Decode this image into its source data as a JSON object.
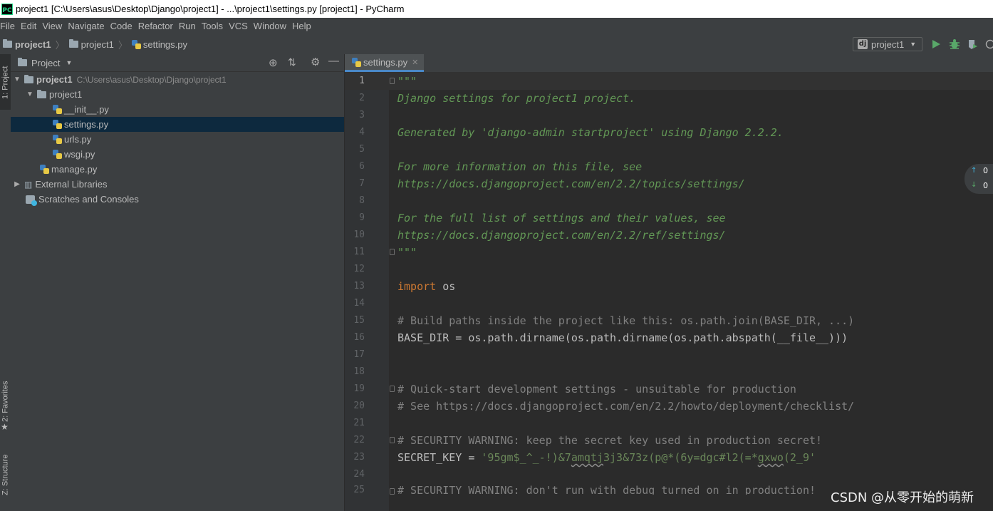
{
  "window": {
    "title": "project1 [C:\\Users\\asus\\Desktop\\Django\\project1] - ...\\project1\\settings.py [project1] - PyCharm",
    "logo": "PC"
  },
  "menu": [
    "File",
    "Edit",
    "View",
    "Navigate",
    "Code",
    "Refactor",
    "Run",
    "Tools",
    "VCS",
    "Window",
    "Help"
  ],
  "breadcrumb": {
    "root": "project1",
    "folder": "project1",
    "file": "settings.py"
  },
  "run_config": {
    "label": "project1",
    "icon": "dj"
  },
  "tool_tabs": {
    "project": "1: Project",
    "favorites": "2: Favorites",
    "structure": "Z: Structure"
  },
  "project_panel": {
    "title": "Project",
    "tree": {
      "root_name": "project1",
      "root_path": "C:\\Users\\asus\\Desktop\\Django\\project1",
      "pkg": "project1",
      "init": "__init__.py",
      "settings": "settings.py",
      "urls": "urls.py",
      "wsgi": "wsgi.py",
      "manage": "manage.py",
      "ext_libs": "External Libraries",
      "scratches": "Scratches and Consoles"
    }
  },
  "editor": {
    "tab_label": "settings.py",
    "line_numbers": [
      "1",
      "2",
      "3",
      "4",
      "5",
      "6",
      "7",
      "8",
      "9",
      "10",
      "11",
      "12",
      "13",
      "14",
      "15",
      "16",
      "17",
      "18",
      "19",
      "20",
      "21",
      "22",
      "23",
      "24",
      "25"
    ],
    "code": {
      "l1": "\"\"\"",
      "l2": "Django settings for project1 project.",
      "l4": "Generated by 'django-admin startproject' using Django 2.2.2.",
      "l6": "For more information on this file, see",
      "l7": "https://docs.djangoproject.com/en/2.2/topics/settings/",
      "l9": "For the full list of settings and their values, see",
      "l10": "https://docs.djangoproject.com/en/2.2/ref/settings/",
      "l11": "\"\"\"",
      "l13_kw": "import",
      "l13_rest": " os",
      "l15": "# Build paths inside the project like this: os.path.join(BASE_DIR, ...)",
      "l16": "BASE_DIR = os.path.dirname(os.path.dirname(os.path.abspath(__file__)))",
      "l19": "# Quick-start development settings - unsuitable for production",
      "l20": "# See https://docs.djangoproject.com/en/2.2/howto/deployment/checklist/",
      "l22": "# SECURITY WARNING: keep the secret key used in production secret!",
      "l23_a": "SECRET_KEY = ",
      "l23_s1": "'95gm$_^_-!)&7",
      "l23_sq1": "amqtj",
      "l23_s2": "3j3&73z(p@*(6y=dgc#l2(=*",
      "l23_sq2": "gxwo",
      "l23_s3": "(2_9'",
      "l25": "# SECURITY WARNING: don't run with debug turned on in production!"
    }
  },
  "inspection_badge": {
    "up": "0",
    "down": "0"
  },
  "watermark": "CSDN @从零开始的萌新",
  "colors": {
    "docstring": "#629755",
    "keyword": "#cc7832",
    "comment": "#808080",
    "string": "#6a8759",
    "selection": "#0d293e",
    "tab_underline": "#4a88c7"
  }
}
